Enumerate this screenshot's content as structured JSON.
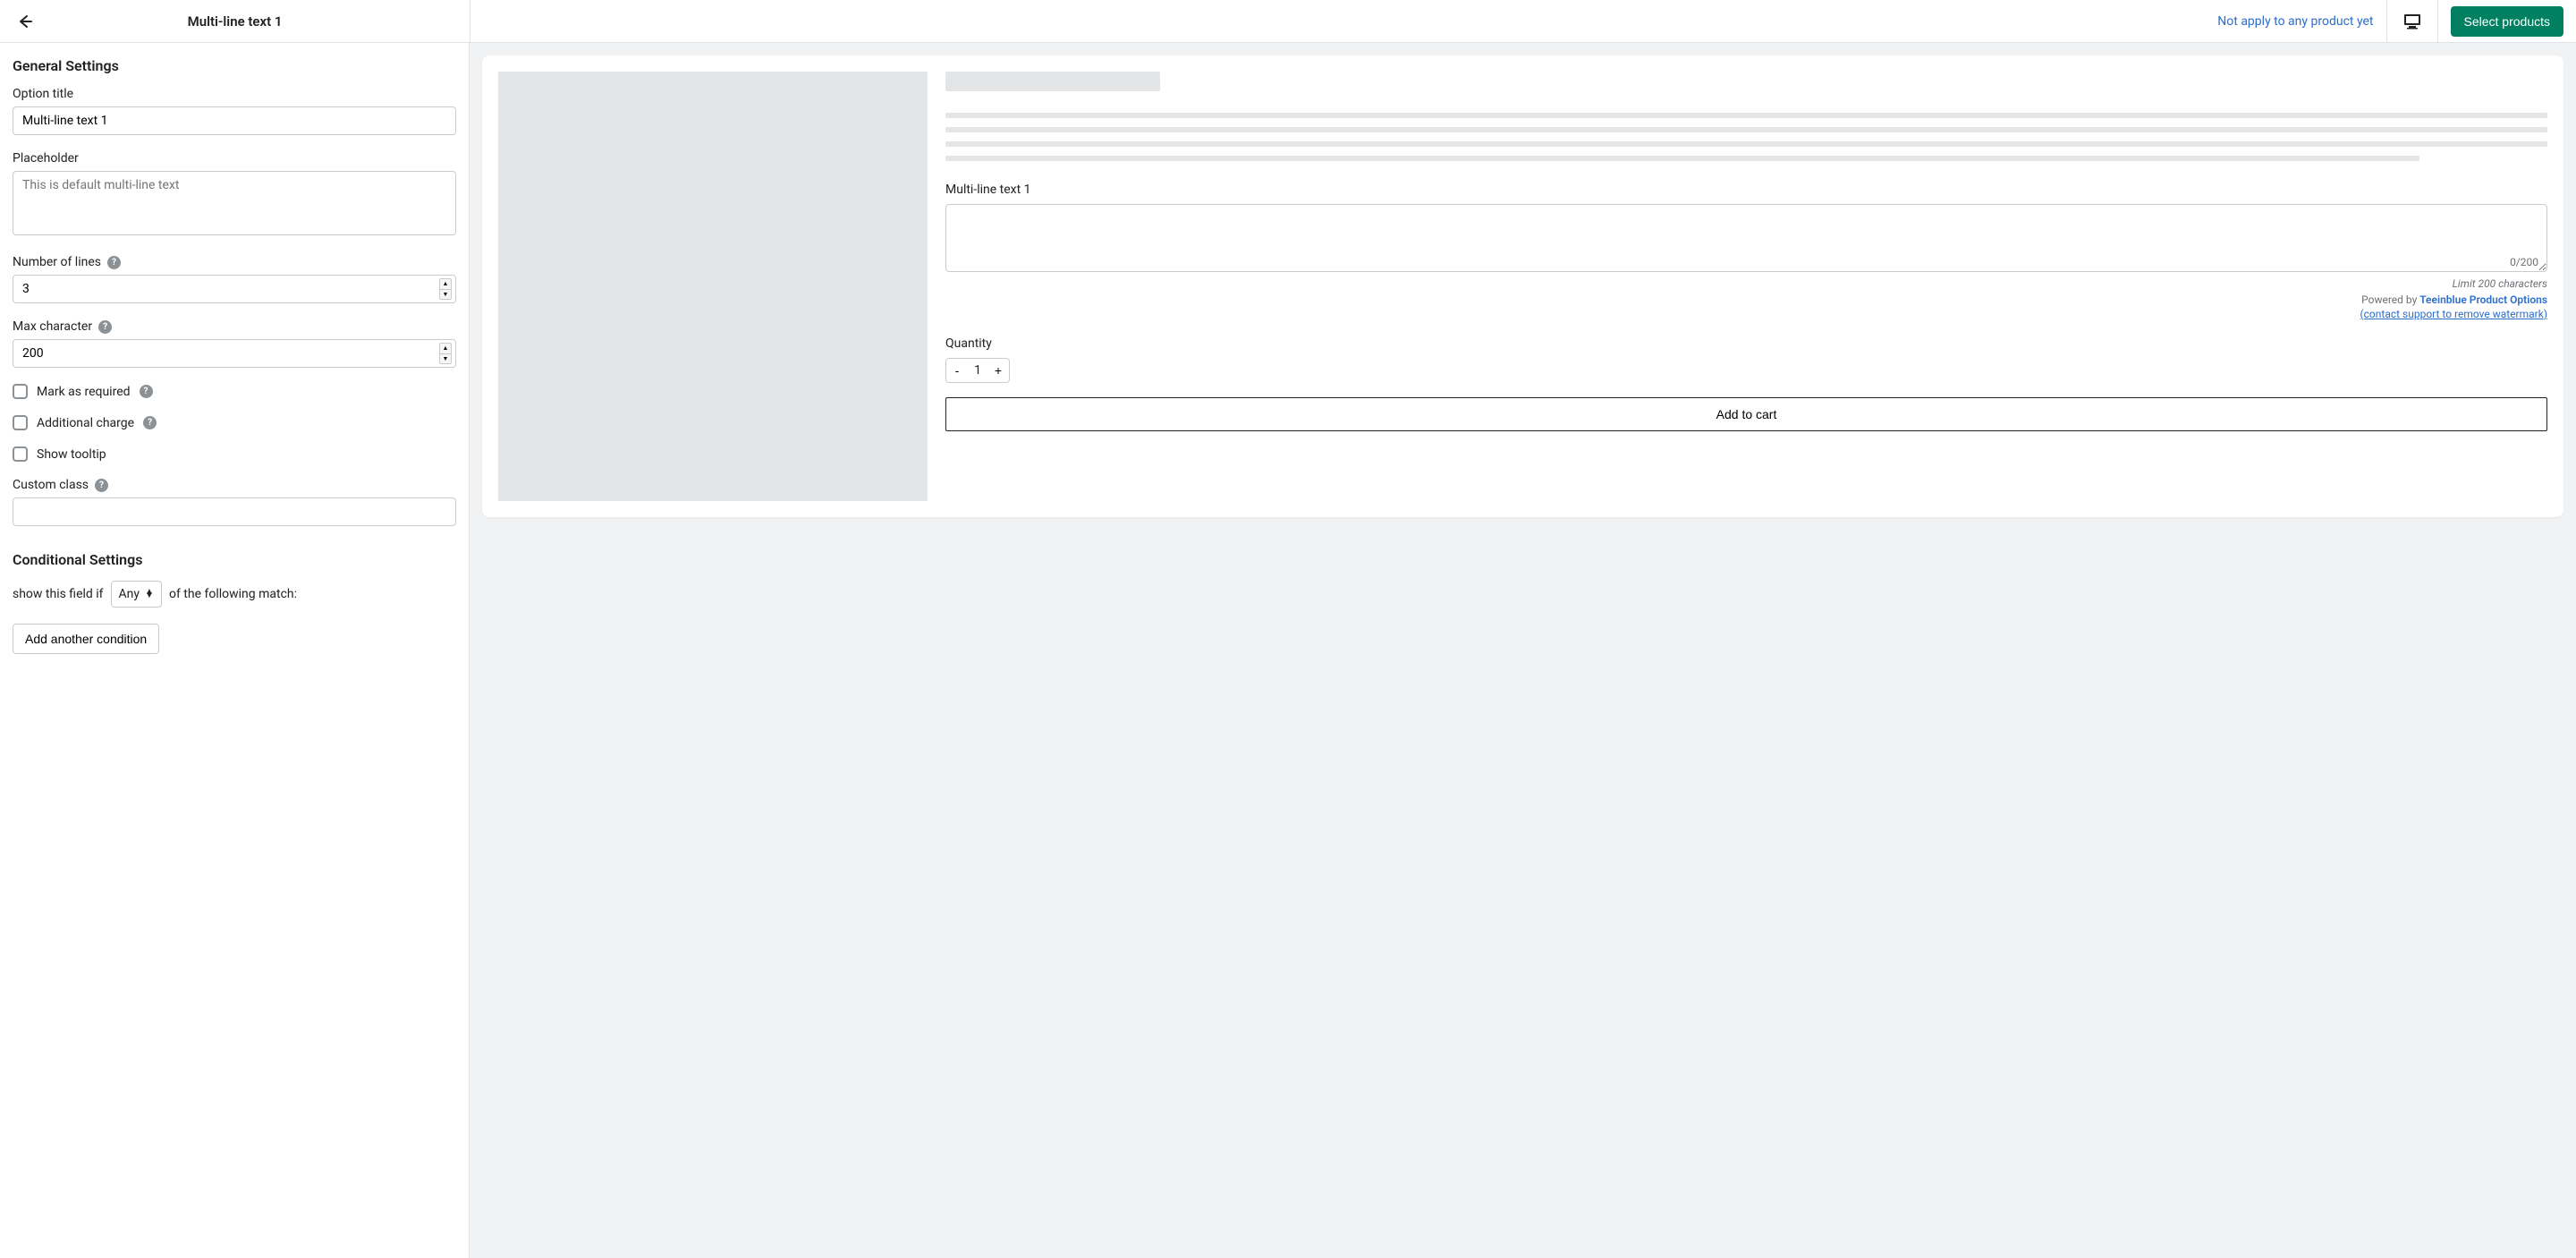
{
  "header": {
    "page_title": "Multi-line text 1",
    "not_apply_text": "Not apply to any product yet",
    "select_products_label": "Select products"
  },
  "form": {
    "general_heading": "General Settings",
    "option_title_label": "Option title",
    "option_title_value": "Multi-line text 1",
    "placeholder_label": "Placeholder",
    "placeholder_value": "This is default multi-line text",
    "number_of_lines_label": "Number of lines",
    "number_of_lines_value": "3",
    "max_char_label": "Max character",
    "max_char_value": "200",
    "mark_required_label": "Mark as required",
    "additional_charge_label": "Additional charge",
    "show_tooltip_label": "Show tooltip",
    "custom_class_label": "Custom class",
    "custom_class_value": "",
    "conditional_heading": "Conditional Settings",
    "cond_prefix": "show this field if",
    "cond_match_value": "Any",
    "cond_suffix": "of the following match:",
    "add_condition_label": "Add another condition"
  },
  "preview": {
    "field_label": "Multi-line text 1",
    "char_count": "0/200",
    "limit_text": "Limit 200 characters",
    "powered_prefix": "Powered by ",
    "powered_brand": "Teeinblue Product Options",
    "watermark_text": "(contact support to remove watermark)",
    "quantity_label": "Quantity",
    "quantity_value": "1",
    "minus": "-",
    "plus": "+",
    "add_to_cart": "Add to cart"
  }
}
